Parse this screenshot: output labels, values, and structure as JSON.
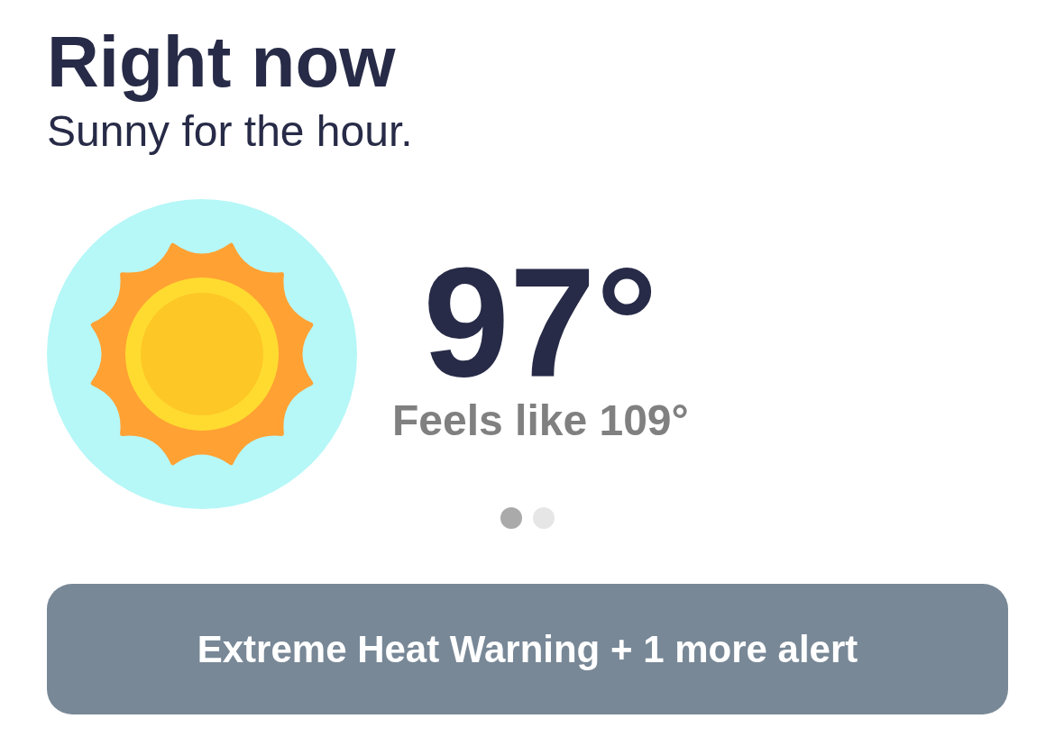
{
  "header": {
    "title": "Right now",
    "summary": "Sunny for the hour."
  },
  "current": {
    "temperature": "97°",
    "feels_like": "Feels like 109°"
  },
  "pages": [
    {
      "selected": true
    },
    {
      "selected": false
    }
  ],
  "alert_button": {
    "label": "Extreme Heat Warning + 1 more alert"
  }
}
